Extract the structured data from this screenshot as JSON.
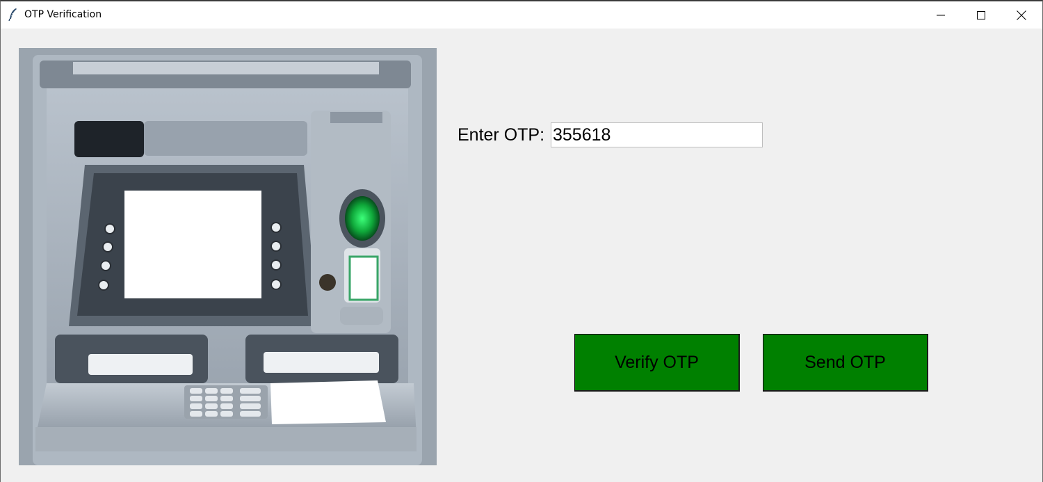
{
  "window": {
    "title": "OTP Verification",
    "controls": {
      "minimize": "minimize-icon",
      "maximize": "maximize-icon",
      "close": "close-icon"
    }
  },
  "image": {
    "subject": "atm-machine"
  },
  "otp": {
    "label": "Enter OTP:",
    "value": "355618"
  },
  "buttons": {
    "verify_label": "Verify OTP",
    "send_label": "Send OTP",
    "color": "#008000"
  }
}
